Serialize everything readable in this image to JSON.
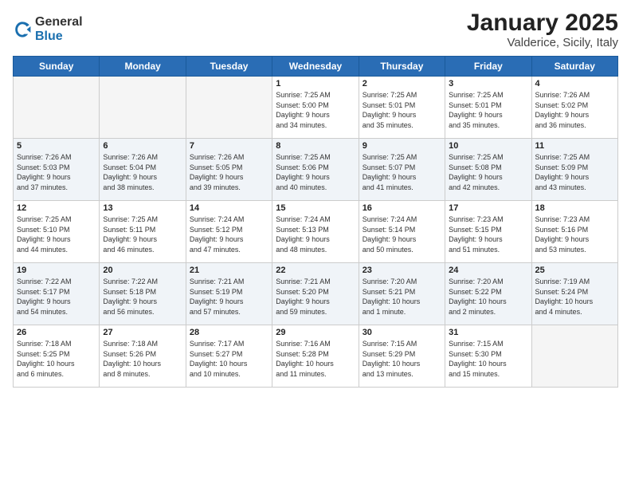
{
  "logo": {
    "general": "General",
    "blue": "Blue"
  },
  "title": "January 2025",
  "location": "Valderice, Sicily, Italy",
  "days_of_week": [
    "Sunday",
    "Monday",
    "Tuesday",
    "Wednesday",
    "Thursday",
    "Friday",
    "Saturday"
  ],
  "weeks": [
    [
      {
        "day": "",
        "info": ""
      },
      {
        "day": "",
        "info": ""
      },
      {
        "day": "",
        "info": ""
      },
      {
        "day": "1",
        "info": "Sunrise: 7:25 AM\nSunset: 5:00 PM\nDaylight: 9 hours\nand 34 minutes."
      },
      {
        "day": "2",
        "info": "Sunrise: 7:25 AM\nSunset: 5:01 PM\nDaylight: 9 hours\nand 35 minutes."
      },
      {
        "day": "3",
        "info": "Sunrise: 7:25 AM\nSunset: 5:01 PM\nDaylight: 9 hours\nand 35 minutes."
      },
      {
        "day": "4",
        "info": "Sunrise: 7:26 AM\nSunset: 5:02 PM\nDaylight: 9 hours\nand 36 minutes."
      }
    ],
    [
      {
        "day": "5",
        "info": "Sunrise: 7:26 AM\nSunset: 5:03 PM\nDaylight: 9 hours\nand 37 minutes."
      },
      {
        "day": "6",
        "info": "Sunrise: 7:26 AM\nSunset: 5:04 PM\nDaylight: 9 hours\nand 38 minutes."
      },
      {
        "day": "7",
        "info": "Sunrise: 7:26 AM\nSunset: 5:05 PM\nDaylight: 9 hours\nand 39 minutes."
      },
      {
        "day": "8",
        "info": "Sunrise: 7:25 AM\nSunset: 5:06 PM\nDaylight: 9 hours\nand 40 minutes."
      },
      {
        "day": "9",
        "info": "Sunrise: 7:25 AM\nSunset: 5:07 PM\nDaylight: 9 hours\nand 41 minutes."
      },
      {
        "day": "10",
        "info": "Sunrise: 7:25 AM\nSunset: 5:08 PM\nDaylight: 9 hours\nand 42 minutes."
      },
      {
        "day": "11",
        "info": "Sunrise: 7:25 AM\nSunset: 5:09 PM\nDaylight: 9 hours\nand 43 minutes."
      }
    ],
    [
      {
        "day": "12",
        "info": "Sunrise: 7:25 AM\nSunset: 5:10 PM\nDaylight: 9 hours\nand 44 minutes."
      },
      {
        "day": "13",
        "info": "Sunrise: 7:25 AM\nSunset: 5:11 PM\nDaylight: 9 hours\nand 46 minutes."
      },
      {
        "day": "14",
        "info": "Sunrise: 7:24 AM\nSunset: 5:12 PM\nDaylight: 9 hours\nand 47 minutes."
      },
      {
        "day": "15",
        "info": "Sunrise: 7:24 AM\nSunset: 5:13 PM\nDaylight: 9 hours\nand 48 minutes."
      },
      {
        "day": "16",
        "info": "Sunrise: 7:24 AM\nSunset: 5:14 PM\nDaylight: 9 hours\nand 50 minutes."
      },
      {
        "day": "17",
        "info": "Sunrise: 7:23 AM\nSunset: 5:15 PM\nDaylight: 9 hours\nand 51 minutes."
      },
      {
        "day": "18",
        "info": "Sunrise: 7:23 AM\nSunset: 5:16 PM\nDaylight: 9 hours\nand 53 minutes."
      }
    ],
    [
      {
        "day": "19",
        "info": "Sunrise: 7:22 AM\nSunset: 5:17 PM\nDaylight: 9 hours\nand 54 minutes."
      },
      {
        "day": "20",
        "info": "Sunrise: 7:22 AM\nSunset: 5:18 PM\nDaylight: 9 hours\nand 56 minutes."
      },
      {
        "day": "21",
        "info": "Sunrise: 7:21 AM\nSunset: 5:19 PM\nDaylight: 9 hours\nand 57 minutes."
      },
      {
        "day": "22",
        "info": "Sunrise: 7:21 AM\nSunset: 5:20 PM\nDaylight: 9 hours\nand 59 minutes."
      },
      {
        "day": "23",
        "info": "Sunrise: 7:20 AM\nSunset: 5:21 PM\nDaylight: 10 hours\nand 1 minute."
      },
      {
        "day": "24",
        "info": "Sunrise: 7:20 AM\nSunset: 5:22 PM\nDaylight: 10 hours\nand 2 minutes."
      },
      {
        "day": "25",
        "info": "Sunrise: 7:19 AM\nSunset: 5:24 PM\nDaylight: 10 hours\nand 4 minutes."
      }
    ],
    [
      {
        "day": "26",
        "info": "Sunrise: 7:18 AM\nSunset: 5:25 PM\nDaylight: 10 hours\nand 6 minutes."
      },
      {
        "day": "27",
        "info": "Sunrise: 7:18 AM\nSunset: 5:26 PM\nDaylight: 10 hours\nand 8 minutes."
      },
      {
        "day": "28",
        "info": "Sunrise: 7:17 AM\nSunset: 5:27 PM\nDaylight: 10 hours\nand 10 minutes."
      },
      {
        "day": "29",
        "info": "Sunrise: 7:16 AM\nSunset: 5:28 PM\nDaylight: 10 hours\nand 11 minutes."
      },
      {
        "day": "30",
        "info": "Sunrise: 7:15 AM\nSunset: 5:29 PM\nDaylight: 10 hours\nand 13 minutes."
      },
      {
        "day": "31",
        "info": "Sunrise: 7:15 AM\nSunset: 5:30 PM\nDaylight: 10 hours\nand 15 minutes."
      },
      {
        "day": "",
        "info": ""
      }
    ]
  ]
}
